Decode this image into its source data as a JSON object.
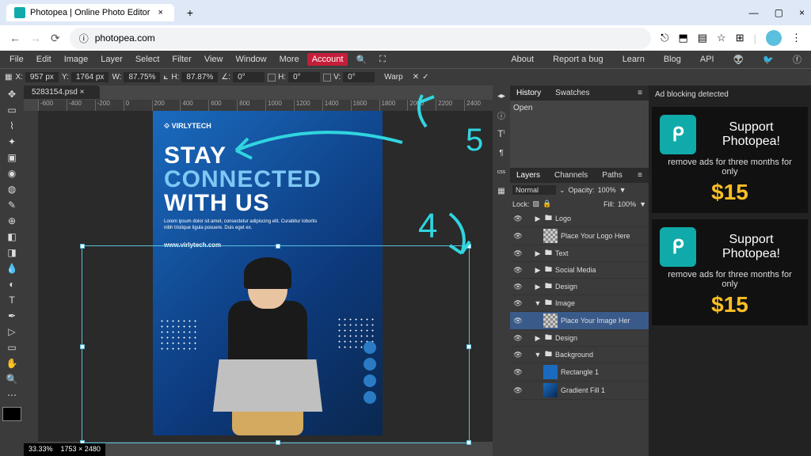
{
  "browser": {
    "tab_title": "Photopea | Online Photo Editor",
    "url": "photopea.com"
  },
  "menubar": {
    "items": [
      "File",
      "Edit",
      "Image",
      "Layer",
      "Select",
      "Filter",
      "View",
      "Window",
      "More"
    ],
    "account": "Account",
    "right": [
      "About",
      "Report a bug",
      "Learn",
      "Blog",
      "API"
    ]
  },
  "optbar": {
    "x_label": "X:",
    "x": "957 px",
    "y_label": "Y:",
    "y": "1764 px",
    "w_label": "W:",
    "w": "87.75%",
    "h_label": "H:",
    "h": "87.87%",
    "a_label": "∠:",
    "a": "0°",
    "hs_label": "H:",
    "hs": "0°",
    "vs_label": "V:",
    "vs": "0°",
    "warp": "Warp"
  },
  "doc_tab": "5283154.psd",
  "ruler_marks": [
    "-600",
    "-400",
    "-200",
    "0",
    "200",
    "400",
    "600",
    "800",
    "1000",
    "1200",
    "1400",
    "1600",
    "1800",
    "2000",
    "2200",
    "2400"
  ],
  "poster": {
    "logo": "⟐ VIRLYTECH",
    "h1": "STAY",
    "h2": "CONNECTED",
    "h3": "WITH US",
    "p": "Lorem ipsum dolor sit amet, consectetur adipiscing elit. Curabitur lobortis nibh tristique ligula posuere. Duis eget ex.",
    "url": "www.virlytech.com"
  },
  "status": {
    "zoom": "33.33%",
    "dims": "1753 × 2480"
  },
  "history": {
    "tabs": [
      "History",
      "Swatches"
    ],
    "items": [
      "Open"
    ]
  },
  "layers": {
    "tabs": [
      "Layers",
      "Channels",
      "Paths"
    ],
    "blend": "Normal",
    "opacity_label": "Opacity:",
    "opacity": "100%",
    "lock_label": "Lock:",
    "fill_label": "Fill:",
    "fill": "100%",
    "items": [
      {
        "name": "Logo",
        "type": "group",
        "indent": 0
      },
      {
        "name": "Place Your Logo Here",
        "type": "layer",
        "indent": 1,
        "thumb": "chk"
      },
      {
        "name": "Text",
        "type": "group",
        "indent": 0
      },
      {
        "name": "Social Media",
        "type": "group",
        "indent": 0
      },
      {
        "name": "Design",
        "type": "group",
        "indent": 0
      },
      {
        "name": "Image",
        "type": "group",
        "indent": 0,
        "open": true
      },
      {
        "name": "Place Your Image Her",
        "type": "layer",
        "indent": 1,
        "thumb": "chk",
        "sel": true
      },
      {
        "name": "Design",
        "type": "group",
        "indent": 0
      },
      {
        "name": "Background",
        "type": "group",
        "indent": 0,
        "open": true
      },
      {
        "name": "Rectangle 1",
        "type": "layer",
        "indent": 1,
        "thumb": "blue"
      },
      {
        "name": "Gradient Fill 1",
        "type": "layer",
        "indent": 1,
        "thumb": "grad"
      }
    ]
  },
  "ads": {
    "detect": "Ad blocking detected",
    "title": "Support Photopea!",
    "sub": "remove ads for three months for only",
    "price": "$15"
  }
}
